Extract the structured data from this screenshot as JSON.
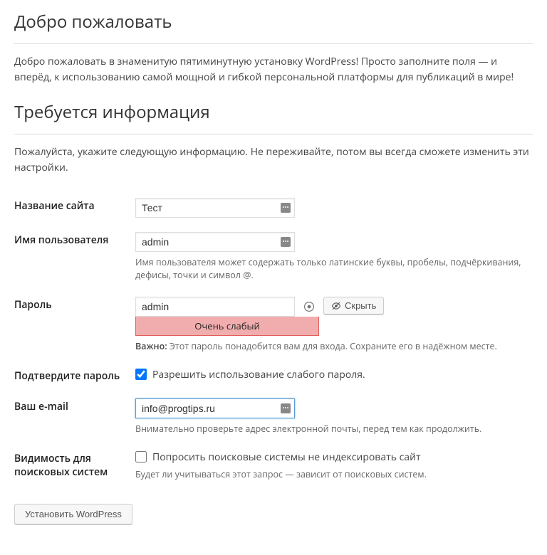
{
  "welcome": {
    "heading": "Добро пожаловать",
    "text": "Добро пожаловать в знаменитую пятиминутную установку WordPress! Просто заполните поля — и вперёд, к использованию самой мощной и гибкой персональной платформы для публикаций в мире!"
  },
  "info": {
    "heading": "Требуется информация",
    "text": "Пожалуйста, укажите следующую информацию. Не переживайте, потом вы всегда сможете изменить эти настройки."
  },
  "fields": {
    "site_title": {
      "label": "Название сайта",
      "value": "Тест"
    },
    "username": {
      "label": "Имя пользователя",
      "value": "admin",
      "hint": "Имя пользователя может содержать только латинские буквы, пробелы, подчёркивания, дефисы, точки и символ @."
    },
    "password": {
      "label": "Пароль",
      "value": "admin",
      "strength": "Очень слабый",
      "hide_btn": "Скрыть",
      "hint_strong": "Важно:",
      "hint": " Этот пароль понадобится вам для входа. Сохраните его в надёжном месте."
    },
    "confirm": {
      "label": "Подтвердите пароль",
      "checkbox_label": "Разрешить использование слабого пароля."
    },
    "email": {
      "label": "Ваш e-mail",
      "value": "info@progtips.ru",
      "hint": "Внимательно проверьте адрес электронной почты, перед тем как продолжить."
    },
    "visibility": {
      "label": "Видимость для поисковых систем",
      "checkbox_label": "Попросить поисковые системы не индексировать сайт",
      "hint": "Будет ли учитываться этот запрос — зависит от поисковых систем."
    }
  },
  "submit": {
    "label": "Установить WordPress"
  }
}
